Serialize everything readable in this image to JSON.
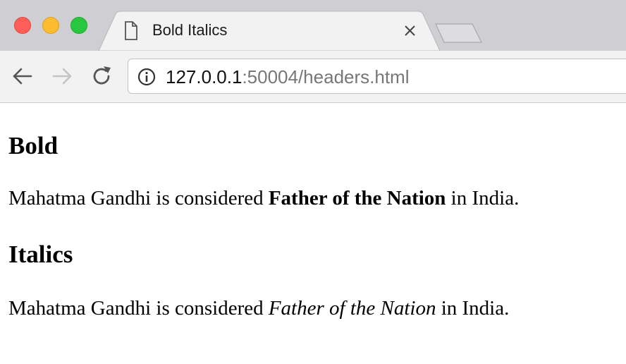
{
  "browser": {
    "tab": {
      "title": "Bold Italics"
    },
    "address_bar": {
      "host": "127.0.0.1",
      "rest": ":50004/headers.html"
    }
  },
  "page": {
    "sections": [
      {
        "heading": "Bold",
        "text_before": "Mahatma Gandhi is considered ",
        "emphasis": "Father of the Nation",
        "text_after": " in India."
      },
      {
        "heading": "Italics",
        "text_before": "Mahatma Gandhi is considered ",
        "emphasis": "Father of the Nation",
        "text_after": " in India."
      }
    ]
  },
  "colors": {
    "tabstrip": "#cfcfd3",
    "toolbar": "#f2f2f2",
    "url_host": "#111111",
    "url_rest": "#777777"
  },
  "icons": [
    "close-window-icon",
    "minimize-window-icon",
    "maximize-window-icon",
    "page-icon",
    "close-tab-icon",
    "back-arrow-icon",
    "forward-arrow-icon",
    "reload-icon",
    "info-icon"
  ]
}
